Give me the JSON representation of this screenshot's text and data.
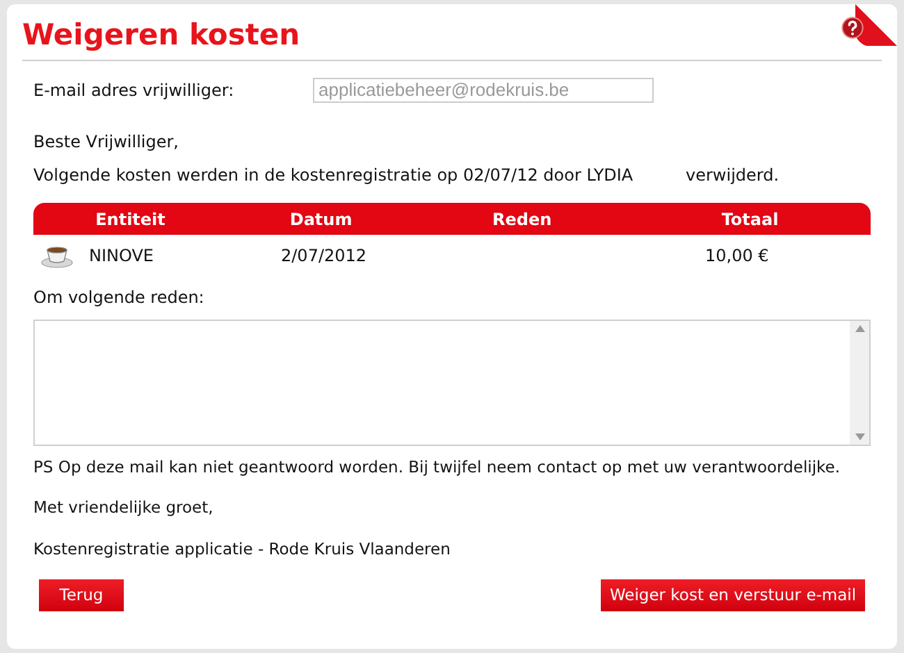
{
  "title": "Weigeren kosten",
  "email": {
    "label": "E-mail adres vrijwilliger:",
    "value": "applicatiebeheer@rodekruis.be"
  },
  "greeting": "Beste Vrijwilliger,",
  "message": {
    "text": "Volgende kosten werden in de kostenregistratie op 02/07/12 door LYDIA",
    "end": "verwijderd."
  },
  "table": {
    "columns": [
      "Entiteit",
      "Datum",
      "Reden",
      "Totaal"
    ],
    "rows": [
      {
        "entiteit": "NINOVE",
        "datum": "2/07/2012",
        "reden": "",
        "totaal": "10,00 €"
      }
    ]
  },
  "reason": {
    "label": "Om volgende reden:"
  },
  "footer": [
    "PS Op deze mail kan niet geantwoord worden. Bij twijfel neem contact op met uw verantwoordelijke.",
    "Met vriendelijke groet,",
    "Kostenregistratie applicatie - Rode Kruis Vlaanderen"
  ],
  "buttons": {
    "back": "Terug",
    "submit": "Weiger kost en verstuur e-mail"
  }
}
